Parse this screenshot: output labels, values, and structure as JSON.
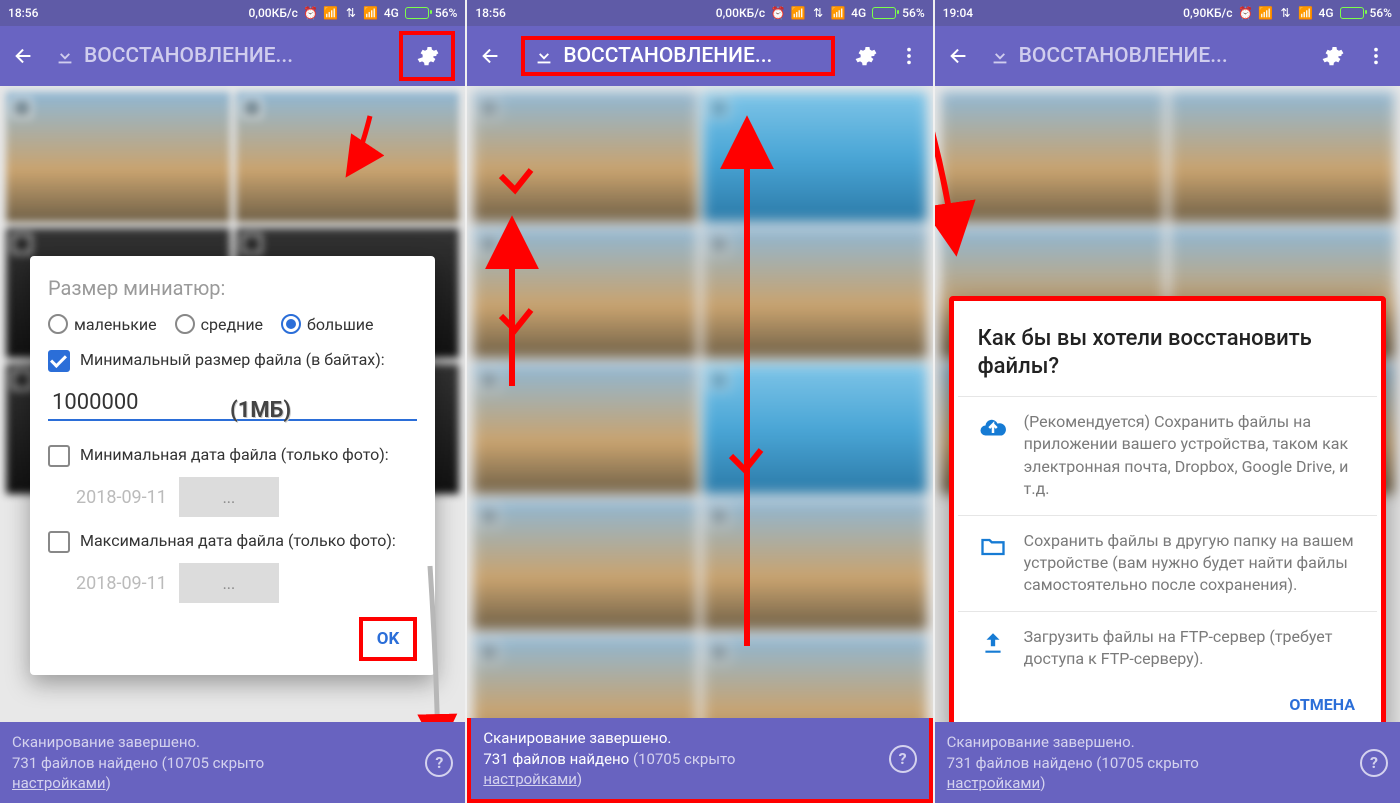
{
  "status": {
    "time1": "18:56",
    "time2": "18:56",
    "time3": "19:04",
    "speed12": "0,00КБ/с",
    "speed3": "0,90КБ/с",
    "net": "4G",
    "batt": "56%"
  },
  "appbar": {
    "title": "ВОССТАНОВЛЕНИЕ..."
  },
  "bottom": {
    "line1": "Сканирование завершено.",
    "line2a": "731 файлов найдено",
    "line2b": " (10705 скрыто ",
    "line2c": "настройками",
    "line2d": ")"
  },
  "dlg1": {
    "heading": "Размер миниатюр:",
    "r1": "маленькие",
    "r2": "средние",
    "r3": "большие",
    "chk1": "Минимальный размер файла (в байтах):",
    "num": "1000000",
    "mbnote": "(1МБ)",
    "chk2": "Минимальная дата файла (только фото):",
    "date1": "2018-09-11",
    "btn1": "...",
    "chk3": "Максимальная дата файла (только фото):",
    "date2": "2018-09-11",
    "btn2": "...",
    "ok": "OK"
  },
  "dlg3": {
    "title": "Как бы вы хотели восстановить файлы?",
    "o1": "(Рекомендуется) Сохранить файлы на приложении вашего устройства, таком как электронная почта, Dropbox, Google Drive, и т.д.",
    "o2": "Сохранить файлы в другую папку на вашем устройстве (вам нужно будет найти файлы самостоятельно после сохранения).",
    "o3": "Загрузить файлы на FTP-сервер (требует доступа к FTP-серверу).",
    "cancel": "ОТМЕНА"
  }
}
